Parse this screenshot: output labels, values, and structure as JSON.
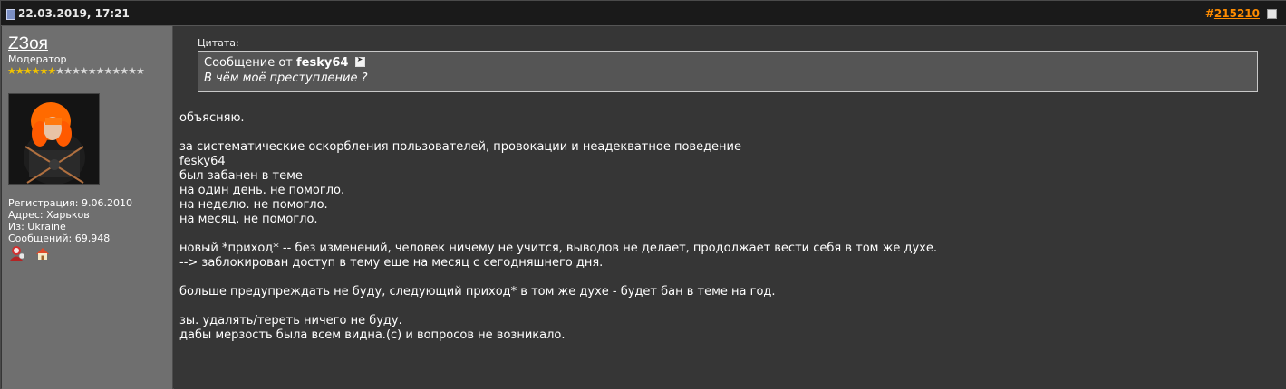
{
  "header": {
    "date": "22.03.2019, 17:21",
    "post_prefix": "#",
    "post_number": "215210"
  },
  "user": {
    "name": "ZЗоя",
    "title": "Модератор",
    "stars_filled": 6,
    "stars_total": 17,
    "registration": "Регистрация: 9.06.2010",
    "address": "Адрес: Харьков",
    "from": "Из: Ukraine",
    "messages": "Сообщений: 69,948",
    "icons": [
      "user-profile-icon",
      "home-icon"
    ]
  },
  "quote": {
    "label": "Цитата:",
    "intro": "Сообщение от",
    "author": "fesky64",
    "text": "В чём моё преступление ?"
  },
  "message": {
    "lines": [
      "объясняю.",
      "",
      "за систематические оскорбления пользователей, провокации и неадекватное поведение",
      "fesky64",
      "был забанен в теме",
      "на один день. не помогло.",
      "на неделю. не помогло.",
      "на месяц. не помогло.",
      "",
      "новый *приход* -- без изменений, человек ничему не учится, выводов не делает, продолжает вести себя в том же духе.",
      "--> заблокирован доступ в тему еще на месяц с сегодняшнего дня.",
      "",
      "больше предупреждать не буду, следующий приход* в том же духе - будет бан в теме на год.",
      "",
      "зы. удалять/тереть ничего не буду.",
      "дабы мерзость была всем видна.(с) и вопросов не возникало."
    ]
  },
  "colors": {
    "header_bg": "#1a1a1a",
    "user_col_bg": "#6f6f6f",
    "content_bg": "#363636",
    "quote_bg": "#555555",
    "post_number": "#ff8c00",
    "star_gold": "#f2c300"
  }
}
